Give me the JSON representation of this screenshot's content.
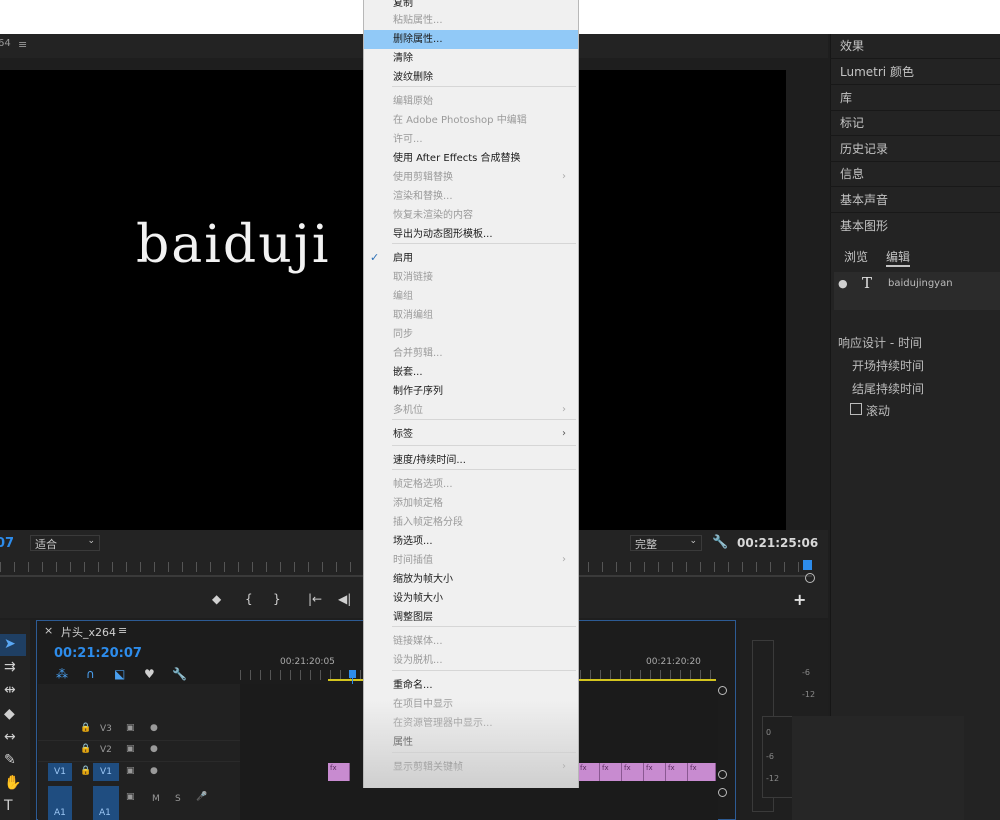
{
  "monitor": {
    "title": "64",
    "menu_icon": "≡",
    "video_text": "baiduji",
    "timecode_left": "07",
    "fit_select": "适合",
    "quality_select": "完整",
    "timecode_right": "00:21:25:06",
    "transport": [
      "◆",
      "{",
      "}",
      "|←",
      "◀|"
    ],
    "add": "+"
  },
  "right_panel": {
    "items": [
      "效果",
      "Lumetri 颜色",
      "库",
      "标记",
      "历史记录",
      "信息",
      "基本声音",
      "基本图形"
    ],
    "tabs": [
      "浏览",
      "编辑"
    ],
    "layer_name": "baidujingyan",
    "responsive_section": "响应设计 - 时间",
    "options": [
      "开场持续时间",
      "结尾持续时间"
    ],
    "roll_label": "滚动"
  },
  "timeline": {
    "title": "片头_x264",
    "menu_icon": "≡",
    "close": "×",
    "timecode": "00:21:20:07",
    "time_marks": [
      "00:21:20:05",
      "00:21:20:20"
    ],
    "tracks": [
      "V3",
      "V2",
      "V1"
    ],
    "v1_label": "V1",
    "a1_label": "A1",
    "a1_m": "M",
    "a1_s": "S",
    "clip_label": "fx"
  },
  "meters": [
    "-6",
    "-12",
    "0",
    "-6",
    "-12"
  ],
  "context_menu": {
    "items": [
      {
        "label": "复制",
        "enabled": true
      },
      {
        "label": "粘贴属性...",
        "enabled": false
      },
      {
        "label": "删除属性...",
        "enabled": true,
        "highlight": true
      },
      {
        "label": "清除",
        "enabled": true
      },
      {
        "label": "波纹删除",
        "enabled": true
      },
      {
        "label": "编辑原始",
        "enabled": false
      },
      {
        "label": "在 Adobe Photoshop 中编辑",
        "enabled": false
      },
      {
        "label": "许可...",
        "enabled": false
      },
      {
        "label": "使用 After Effects 合成替换",
        "enabled": true
      },
      {
        "label": "使用剪辑替换",
        "enabled": false,
        "submenu": true
      },
      {
        "label": "渲染和替换...",
        "enabled": false
      },
      {
        "label": "恢复未渲染的内容",
        "enabled": false
      },
      {
        "label": "导出为动态图形模板...",
        "enabled": true
      },
      {
        "label": "启用",
        "enabled": true,
        "checked": true
      },
      {
        "label": "取消链接",
        "enabled": false
      },
      {
        "label": "编组",
        "enabled": false
      },
      {
        "label": "取消编组",
        "enabled": false
      },
      {
        "label": "同步",
        "enabled": false
      },
      {
        "label": "合并剪辑...",
        "enabled": false
      },
      {
        "label": "嵌套...",
        "enabled": true
      },
      {
        "label": "制作子序列",
        "enabled": true
      },
      {
        "label": "多机位",
        "enabled": false,
        "submenu": true
      },
      {
        "label": "标签",
        "enabled": true,
        "submenu": true
      },
      {
        "label": "速度/持续时间...",
        "enabled": true
      },
      {
        "label": "帧定格选项...",
        "enabled": false
      },
      {
        "label": "添加帧定格",
        "enabled": false
      },
      {
        "label": "插入帧定格分段",
        "enabled": false
      },
      {
        "label": "场选项...",
        "enabled": true
      },
      {
        "label": "时间插值",
        "enabled": false,
        "submenu": true
      },
      {
        "label": "缩放为帧大小",
        "enabled": true
      },
      {
        "label": "设为帧大小",
        "enabled": true
      },
      {
        "label": "调整图层",
        "enabled": true
      },
      {
        "label": "链接媒体...",
        "enabled": false
      },
      {
        "label": "设为脱机...",
        "enabled": false
      },
      {
        "label": "重命名...",
        "enabled": true
      },
      {
        "label": "在项目中显示",
        "enabled": false
      },
      {
        "label": "在资源管理器中显示...",
        "enabled": false
      },
      {
        "label": "属性",
        "enabled": true
      },
      {
        "label": "显示剪辑关键帧",
        "enabled": true,
        "submenu": true
      }
    ]
  },
  "colors": {
    "accent_blue": "#2d8ceb",
    "menu_highlight": "#91c9f7",
    "clip_pink": "#c88bd0",
    "work_area_yellow": "#d4c51e"
  }
}
